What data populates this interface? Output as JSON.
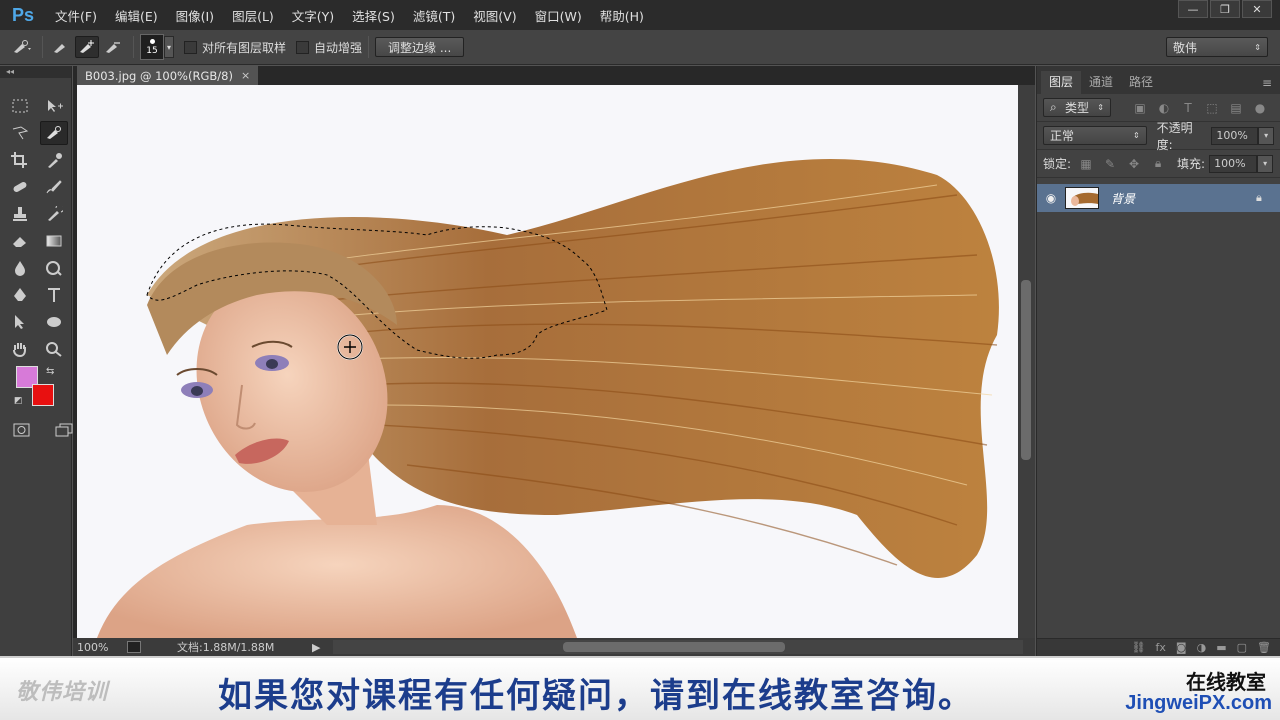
{
  "app": {
    "logo": "Ps"
  },
  "menu": [
    "文件(F)",
    "编辑(E)",
    "图像(I)",
    "图层(L)",
    "文字(Y)",
    "选择(S)",
    "滤镜(T)",
    "视图(V)",
    "窗口(W)",
    "帮助(H)"
  ],
  "window_controls": {
    "minimize": "—",
    "restore": "❐",
    "close": "✕"
  },
  "options": {
    "brush_size": "15",
    "sample_all_layers": "对所有图层取样",
    "auto_enhance": "自动增强",
    "refine_edge": "调整边缘 ...",
    "workspace": "敬伟"
  },
  "document": {
    "tab_title": "B003.jpg @ 100%(RGB/8)",
    "zoom": "100%",
    "doc_size": "文档:1.88M/1.88M"
  },
  "colors": {
    "foreground": "#d77ad8",
    "background": "#e81010",
    "layer_selected": "#5a7290",
    "subtitle": "#1c3d8c"
  },
  "panels": {
    "tabs": [
      "图层",
      "通道",
      "路径"
    ],
    "filter_kind": "类型",
    "blend_mode": "正常",
    "opacity_label": "不透明度:",
    "opacity_value": "100%",
    "lock_label": "锁定:",
    "fill_label": "填充:",
    "fill_value": "100%",
    "layer_name": "背景"
  },
  "banner": {
    "logo": "敬伟培训",
    "text": "如果您对课程有任何疑问，请到在线教室咨询。",
    "right_top": "在线教室",
    "right_bottom": "JingweiPX.com"
  }
}
